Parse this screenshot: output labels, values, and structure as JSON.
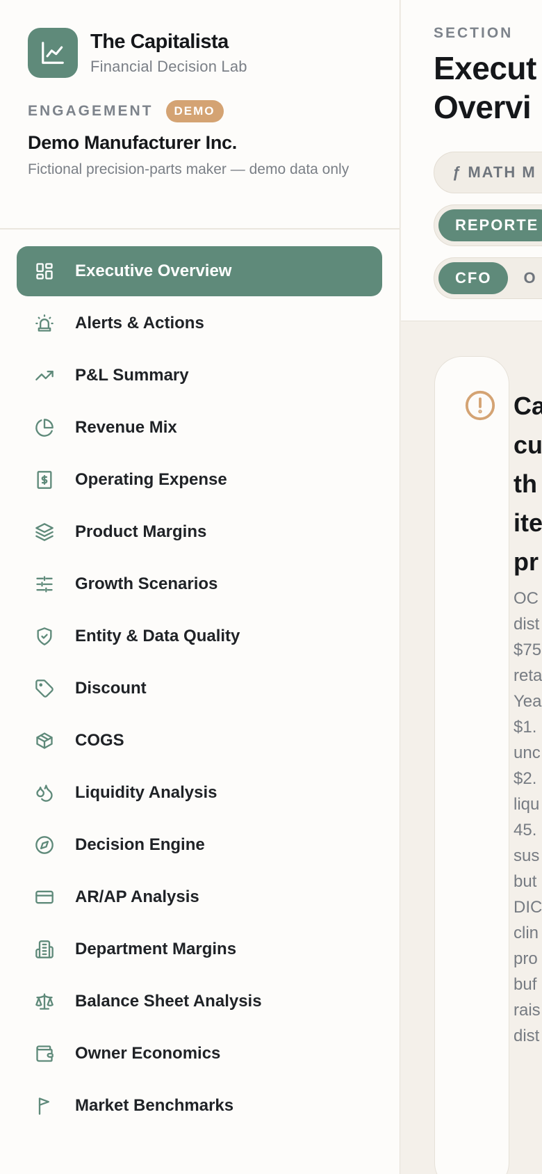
{
  "brand": {
    "title": "The Capitalista",
    "subtitle": "Financial Decision Lab",
    "logo_icon": "chart-line-icon"
  },
  "engagement": {
    "label": "ENGAGEMENT",
    "badge": "DEMO",
    "name": "Demo Manufacturer Inc.",
    "description": "Fictional precision-parts maker — demo data only"
  },
  "nav": {
    "items": [
      {
        "label": "Executive Overview",
        "icon": "layout-grid-icon",
        "active": true
      },
      {
        "label": "Alerts & Actions",
        "icon": "siren-icon"
      },
      {
        "label": "P&L Summary",
        "icon": "trending-up-icon"
      },
      {
        "label": "Revenue Mix",
        "icon": "pie-chart-icon"
      },
      {
        "label": "Operating Expense",
        "icon": "receipt-dollar-icon"
      },
      {
        "label": "Product Margins",
        "icon": "layers-icon"
      },
      {
        "label": "Growth Scenarios",
        "icon": "sliders-icon"
      },
      {
        "label": "Entity & Data Quality",
        "icon": "shield-check-icon"
      },
      {
        "label": "Discount",
        "icon": "tag-icon"
      },
      {
        "label": "COGS",
        "icon": "package-icon"
      },
      {
        "label": "Liquidity Analysis",
        "icon": "droplets-icon"
      },
      {
        "label": "Decision Engine",
        "icon": "compass-icon"
      },
      {
        "label": "AR/AP Analysis",
        "icon": "credit-card-icon"
      },
      {
        "label": "Department Margins",
        "icon": "building-icon"
      },
      {
        "label": "Balance Sheet Analysis",
        "icon": "scale-icon"
      },
      {
        "label": "Owner Economics",
        "icon": "wallet-icon"
      },
      {
        "label": "Market Benchmarks",
        "icon": "flag-icon"
      }
    ]
  },
  "header": {
    "section_label": "SECTION",
    "title_line1": "Execut",
    "title_line2": "Overvi",
    "pill1": "ƒ MATH M",
    "pill2": "REPORTE",
    "pill3_active": "CFO",
    "pill3_next": "O"
  },
  "card": {
    "icon": "alert-circle-icon",
    "title_lines": [
      "Ca",
      "cu",
      "th",
      "ite",
      "pr"
    ],
    "body_lines": [
      "OC",
      "dist",
      "$75",
      "reta",
      "Yea",
      "$1.",
      "unc",
      "$2.",
      "liqu",
      "45.",
      "sus",
      "but",
      "DIC",
      "clin",
      "pro",
      "buf",
      "rais",
      "dist"
    ]
  },
  "colors": {
    "accent": "#5f8a7a",
    "badge": "#d4a373",
    "alert": "#d4a373",
    "background": "#f4f0ea"
  }
}
